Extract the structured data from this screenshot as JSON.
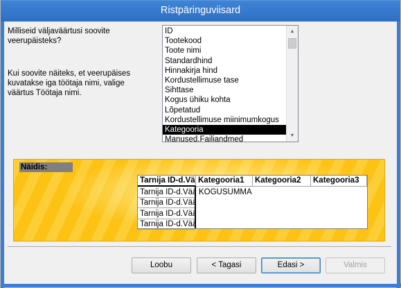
{
  "window": {
    "title": "Ristpäringuviisard"
  },
  "instructions": {
    "question": "Milliseid väljaväärtusi soovite veerupäisteks?",
    "hint": "Kui soovite näiteks, et veerupäises kuvatakse iga töötaja nimi, valige väärtus Töötaja nimi."
  },
  "field_list": {
    "items": [
      "ID",
      "Tootekood",
      "Toote nimi",
      "Standardhind",
      "Hinnakirja hind",
      "Kordustellimuse tase",
      "Sihttase",
      "Kogus ühiku kohta",
      "Lõpetatud",
      "Kordustellimuse miinimumkogus",
      "Kategooria",
      "Manused.Failiandmed"
    ],
    "selected": "Kategooria"
  },
  "sample": {
    "label": "Näidis:",
    "row_header": "Tarnija ID-d.Väärtus",
    "column_headers": [
      "Kategooria1",
      "Kategooria2",
      "Kategooria3"
    ],
    "rows": [
      "Tarnija ID-d.Väärtus",
      "Tarnija ID-d.Väärtus",
      "Tarnija ID-d.Väärtus",
      "Tarnija ID-d.Väärtus"
    ],
    "value_label": "KOGUSUMMA"
  },
  "buttons": {
    "cancel": "Loobu",
    "back": "< Tagasi",
    "next": "Edasi >",
    "finish": "Valmis"
  }
}
